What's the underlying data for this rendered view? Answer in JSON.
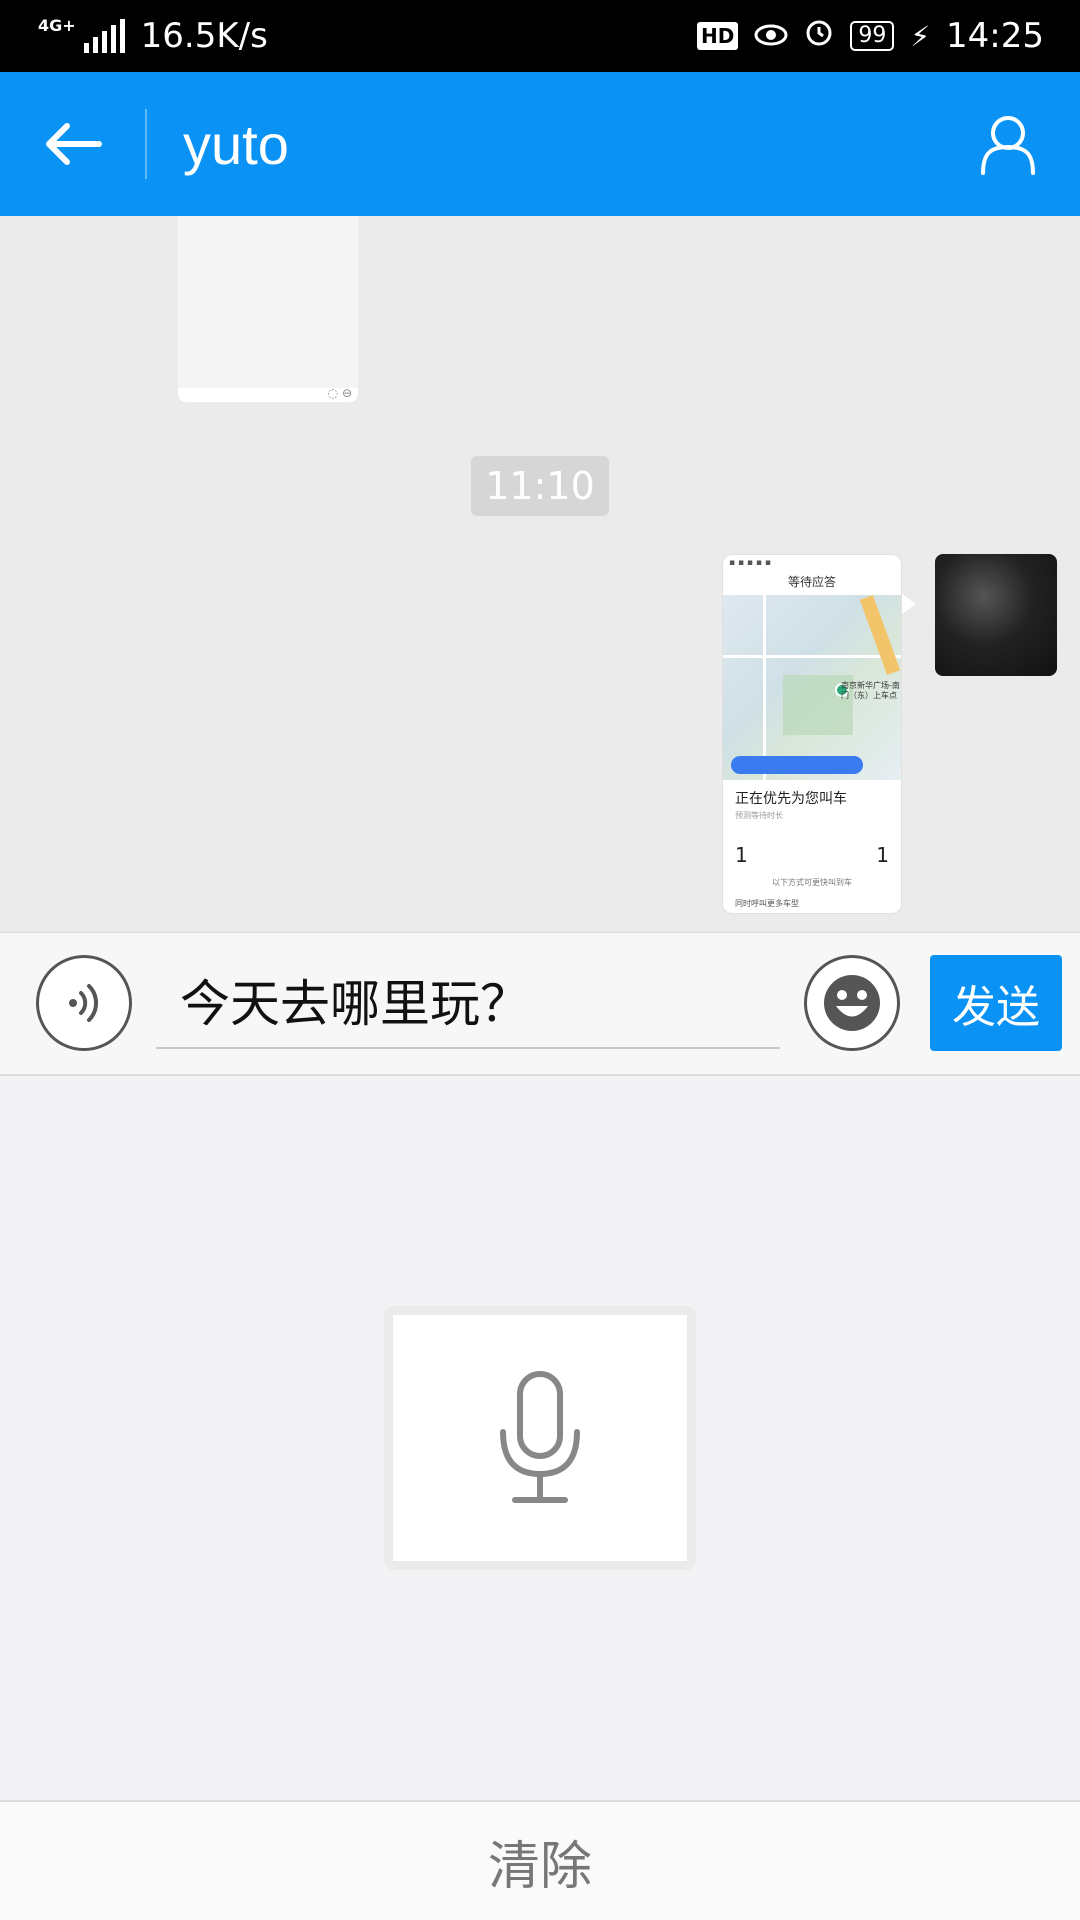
{
  "status_bar": {
    "network_type": "4G+",
    "speed": "16.5K/s",
    "hd_label": "HD",
    "battery": "99",
    "time": "14:25",
    "icons": [
      "signal-icon",
      "hd-icon",
      "eye-icon",
      "alarm-icon",
      "battery-icon",
      "charging-icon"
    ]
  },
  "header": {
    "title": "yuto",
    "back_icon": "arrow-left-icon",
    "profile_icon": "person-icon"
  },
  "messages": {
    "timestamp": "11:10",
    "screenshot": {
      "title": "等待应答",
      "pin_label": "南京新华广场-南门（东）上车点",
      "card_title": "正在优先为您叫车",
      "card_subtitle": "预测等待时长",
      "left_count": "1",
      "right_count": "1",
      "line1": "以下方式可更快叫到车",
      "line2": "同时呼叫更多车型"
    }
  },
  "input": {
    "value": "今天去哪里玩？",
    "send_label": "发送",
    "voice_icon": "voice-wave-icon",
    "emoji_icon": "smile-emoji-icon"
  },
  "voice_panel": {
    "mic_icon": "microphone-icon",
    "clear_label": "清除"
  },
  "colors": {
    "primary": "#0A93F4",
    "chat_bg": "#EBEBEB",
    "panel_bg": "#F3F3F5"
  }
}
